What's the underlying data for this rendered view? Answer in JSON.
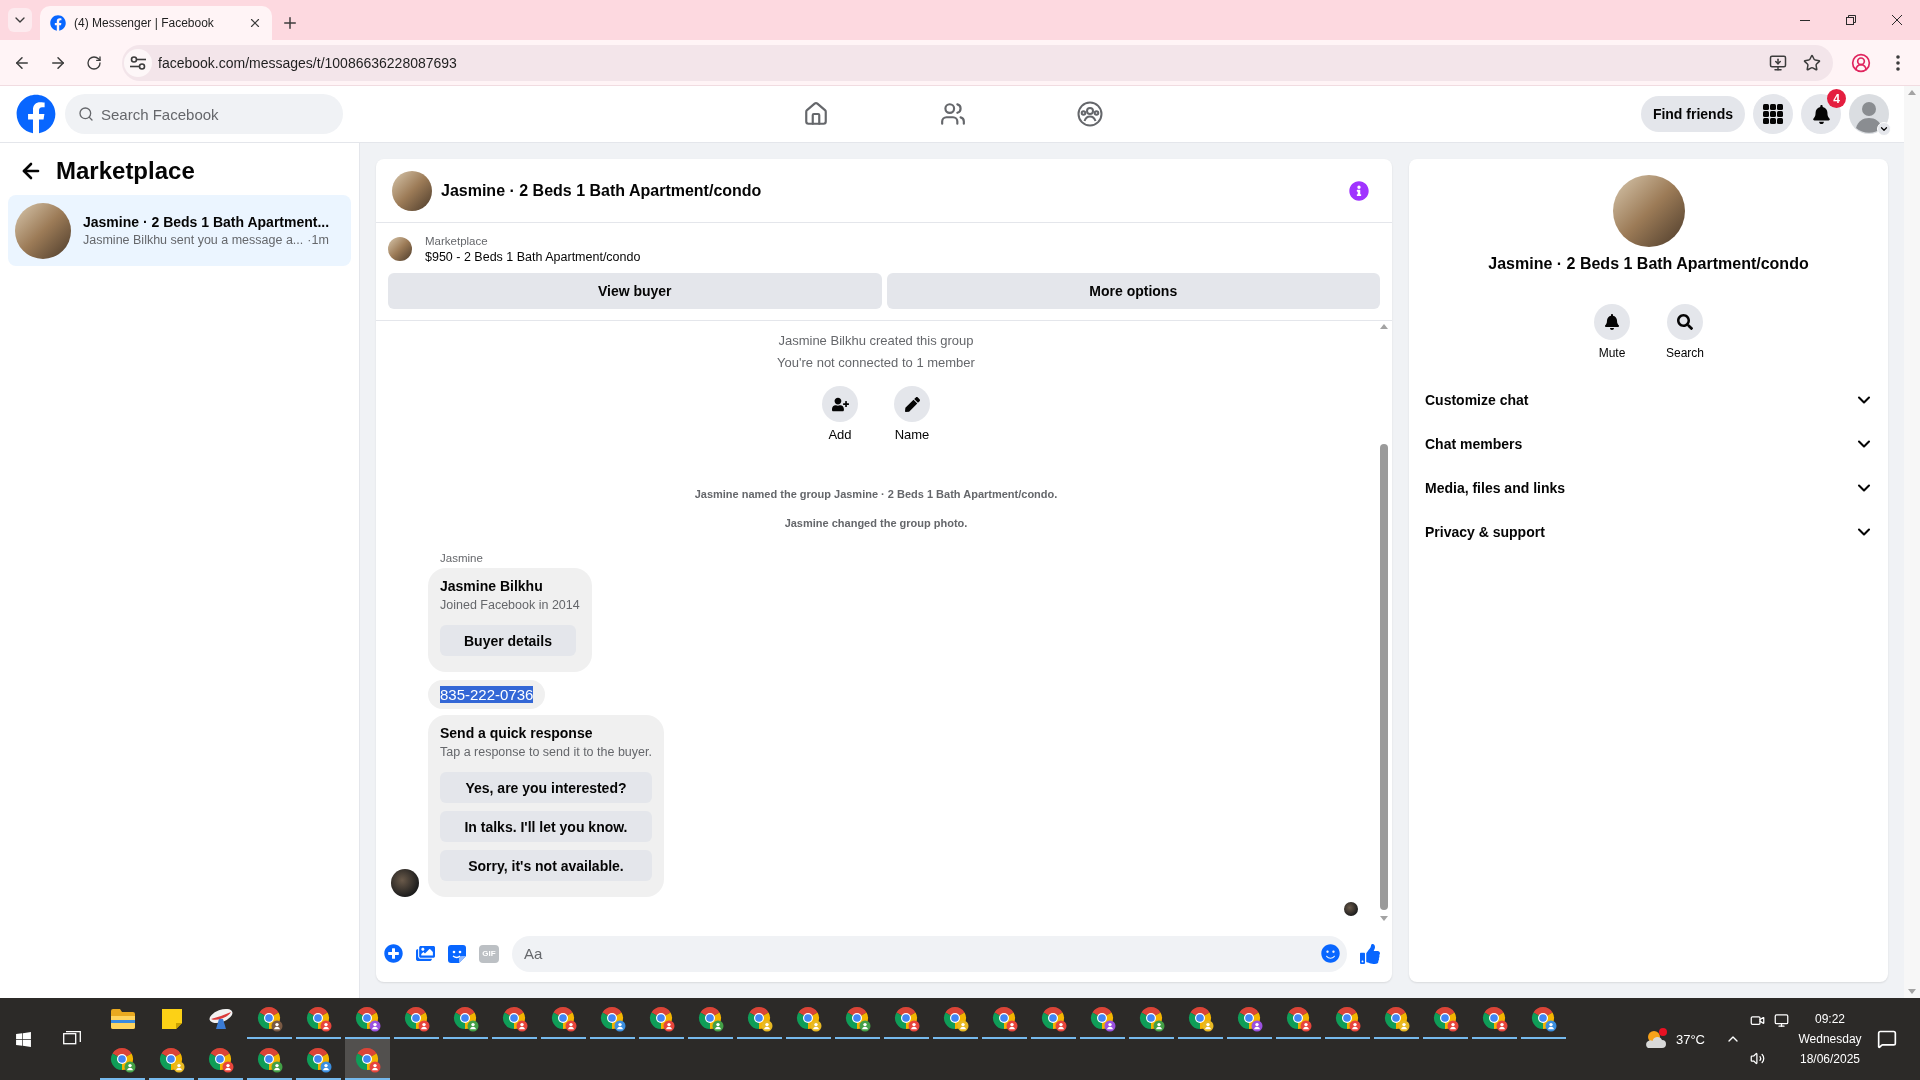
{
  "browser": {
    "tab": {
      "title": "(4) Messenger | Facebook",
      "selected": true
    },
    "url": "facebook.com/messages/t/10086636228087693"
  },
  "header": {
    "search": {
      "placeholder": "Search Facebook"
    },
    "find_friends": "Find friends",
    "notification_count": "4"
  },
  "sidebar": {
    "title": "Marketplace",
    "threads": [
      {
        "title": "Jasmine · 2 Beds 1 Bath Apartment...",
        "preview": "Jasmine Bilkhu sent you a message a...",
        "time": "·1m",
        "selected": true
      }
    ]
  },
  "chat": {
    "title": "Jasmine · 2 Beds 1 Bath Apartment/condo",
    "listing": {
      "source": "Marketplace",
      "summary": "$950 - 2 Beds 1 Bath Apartment/condo"
    },
    "actions": [
      "View buyer",
      "More options"
    ],
    "notices": [
      "Jasmine Bilkhu created this group",
      "You're not connected to 1 member"
    ],
    "group_actions": [
      {
        "kind": "add",
        "label": "Add"
      },
      {
        "kind": "name",
        "label": "Name"
      }
    ],
    "events": [
      "Jasmine named the group Jasmine · 2 Beds 1 Bath Apartment/condo.",
      "Jasmine changed the group photo."
    ],
    "sender": "Jasmine",
    "messages": [
      {
        "kind": "profile_card",
        "name": "Jasmine Bilkhu",
        "subtitle": "Joined Facebook in 2014",
        "button": "Buyer details"
      },
      {
        "kind": "text",
        "text": "835-222-0736",
        "highlighted": true
      },
      {
        "kind": "quick_replies",
        "title": "Send a quick response",
        "subtitle": "Tap a response to send it to the buyer.",
        "options": [
          "Yes, are you interested?",
          "In talks. I'll let you know.",
          "Sorry, it's not available."
        ]
      }
    ],
    "composer": {
      "gif": "GIF",
      "placeholder": "Aa"
    }
  },
  "details": {
    "title": "Jasmine · 2 Beds 1 Bath Apartment/condo",
    "actions": [
      {
        "kind": "mute",
        "label": "Mute"
      },
      {
        "kind": "search",
        "label": "Search"
      }
    ],
    "sections": [
      {
        "label": "Customize chat",
        "expanded": false
      },
      {
        "label": "Chat members",
        "expanded": false
      },
      {
        "label": "Media, files and links",
        "expanded": false
      },
      {
        "label": "Privacy & support",
        "expanded": false
      }
    ]
  },
  "taskbar": {
    "apps": [
      {
        "kind": "explorer",
        "running": false,
        "selected": false
      },
      {
        "kind": "notes",
        "running": false,
        "selected": false
      },
      {
        "kind": "dish",
        "running": false,
        "selected": false
      },
      {
        "kind": "chrome",
        "color": "#7a5a44",
        "running": true,
        "selected": false
      },
      {
        "kind": "chrome",
        "color": "#e8453c",
        "running": true,
        "selected": false
      },
      {
        "kind": "chrome",
        "color": "#9b51e0",
        "running": true,
        "selected": false
      },
      {
        "kind": "chrome",
        "color": "#e8453c",
        "running": true,
        "selected": false
      },
      {
        "kind": "chrome",
        "color": "#43a047",
        "running": true,
        "selected": false
      },
      {
        "kind": "chrome",
        "color": "#e8453c",
        "running": true,
        "selected": false
      },
      {
        "kind": "chrome",
        "color": "#e8453c",
        "running": true,
        "selected": false
      },
      {
        "kind": "chrome",
        "color": "#3b8fe0",
        "running": true,
        "selected": false
      },
      {
        "kind": "chrome",
        "color": "#e8453c",
        "running": true,
        "selected": false
      },
      {
        "kind": "chrome",
        "color": "#43a047",
        "running": true,
        "selected": false
      },
      {
        "kind": "chrome",
        "color": "#e8b923",
        "running": true,
        "selected": false
      },
      {
        "kind": "chrome",
        "color": "#e8b923",
        "running": true,
        "selected": false
      },
      {
        "kind": "chrome",
        "color": "#43a047",
        "running": true,
        "selected": false
      },
      {
        "kind": "chrome",
        "color": "#e8453c",
        "running": true,
        "selected": false
      },
      {
        "kind": "chrome",
        "color": "#e8b923",
        "running": true,
        "selected": false
      },
      {
        "kind": "chrome",
        "color": "#e8453c",
        "running": true,
        "selected": false
      },
      {
        "kind": "chrome",
        "color": "#e8453c",
        "running": true,
        "selected": false
      },
      {
        "kind": "chrome",
        "color": "#9b51e0",
        "running": true,
        "selected": false
      },
      {
        "kind": "chrome",
        "color": "#43a047",
        "running": true,
        "selected": false
      },
      {
        "kind": "chrome",
        "color": "#e8b923",
        "running": true,
        "selected": false
      },
      {
        "kind": "chrome",
        "color": "#9b51e0",
        "running": true,
        "selected": false
      },
      {
        "kind": "chrome",
        "color": "#e8453c",
        "running": true,
        "selected": false
      },
      {
        "kind": "chrome",
        "color": "#e8453c",
        "running": true,
        "selected": false
      },
      {
        "kind": "chrome",
        "color": "#e8b923",
        "running": true,
        "selected": false
      },
      {
        "kind": "chrome",
        "color": "#e8453c",
        "running": true,
        "selected": false
      },
      {
        "kind": "chrome",
        "color": "#e8453c",
        "running": true,
        "selected": false
      },
      {
        "kind": "chrome",
        "color": "#3b8fe0",
        "running": true,
        "selected": false
      },
      {
        "kind": "chrome",
        "color": "#43a047",
        "running": true,
        "selected": false
      },
      {
        "kind": "chrome",
        "color": "#e8b923",
        "running": true,
        "selected": false
      },
      {
        "kind": "chrome",
        "color": "#e8453c",
        "running": true,
        "selected": false
      },
      {
        "kind": "chrome",
        "color": "#43a047",
        "running": true,
        "selected": false
      },
      {
        "kind": "chrome",
        "color": "#3b8fe0",
        "running": true,
        "selected": false
      },
      {
        "kind": "chrome",
        "color": "#e8453c",
        "running": true,
        "selected": true
      }
    ],
    "weather": "37°C",
    "clock": {
      "time": "09:22",
      "day": "Wednesday",
      "date": "18/06/2025"
    }
  }
}
